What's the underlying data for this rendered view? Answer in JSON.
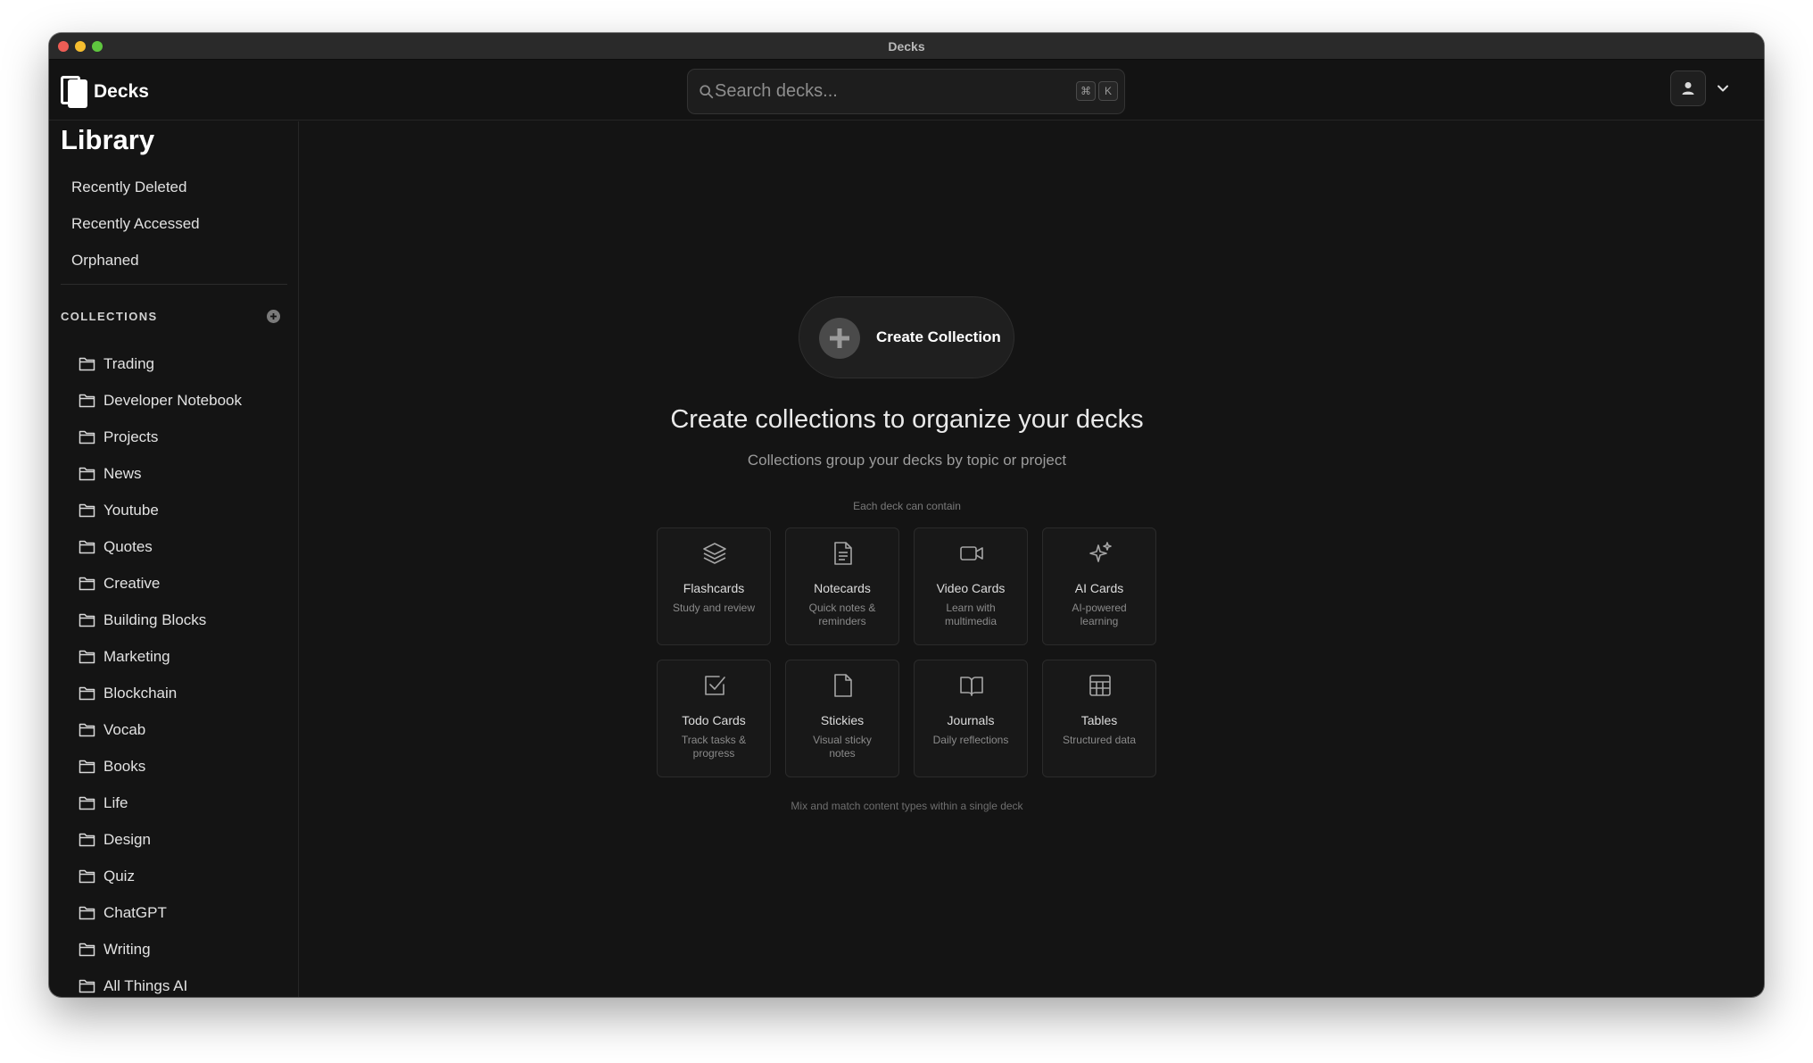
{
  "window": {
    "title": "Decks"
  },
  "appbar": {
    "logo_text": "Decks",
    "search_placeholder": "Search decks...",
    "shortcut_mod": "⌘",
    "shortcut_key": "K"
  },
  "sidebar": {
    "title": "Library",
    "library_items": [
      {
        "label": "Recently Deleted"
      },
      {
        "label": "Recently Accessed"
      },
      {
        "label": "Orphaned"
      }
    ],
    "collections_header": "COLLECTIONS",
    "collections": [
      {
        "label": "Trading"
      },
      {
        "label": "Developer Notebook"
      },
      {
        "label": "Projects"
      },
      {
        "label": "News"
      },
      {
        "label": "Youtube"
      },
      {
        "label": "Quotes"
      },
      {
        "label": "Creative"
      },
      {
        "label": "Building Blocks"
      },
      {
        "label": "Marketing"
      },
      {
        "label": "Blockchain"
      },
      {
        "label": "Vocab"
      },
      {
        "label": "Books"
      },
      {
        "label": "Life"
      },
      {
        "label": "Design"
      },
      {
        "label": "Quiz"
      },
      {
        "label": "ChatGPT"
      },
      {
        "label": "Writing"
      },
      {
        "label": "All Things AI"
      }
    ]
  },
  "main": {
    "create_button_label": "Create Collection",
    "headline": "Create collections to organize your decks",
    "subline": "Collections group your decks by topic or project",
    "caption": "Each deck can contain",
    "cards": [
      {
        "title": "Flashcards",
        "desc": "Study and review",
        "icon": "layers-icon"
      },
      {
        "title": "Notecards",
        "desc": "Quick notes & reminders",
        "icon": "document-icon"
      },
      {
        "title": "Video Cards",
        "desc": "Learn with multimedia",
        "icon": "video-icon"
      },
      {
        "title": "AI Cards",
        "desc": "AI-powered learning",
        "icon": "sparkles-icon"
      },
      {
        "title": "Todo Cards",
        "desc": "Track tasks & progress",
        "icon": "checkbox-icon"
      },
      {
        "title": "Stickies",
        "desc": "Visual sticky notes",
        "icon": "sticky-note-icon"
      },
      {
        "title": "Journals",
        "desc": "Daily reflections",
        "icon": "open-book-icon"
      },
      {
        "title": "Tables",
        "desc": "Structured data",
        "icon": "table-icon"
      }
    ],
    "footnote": "Mix and match content types within a single deck"
  }
}
